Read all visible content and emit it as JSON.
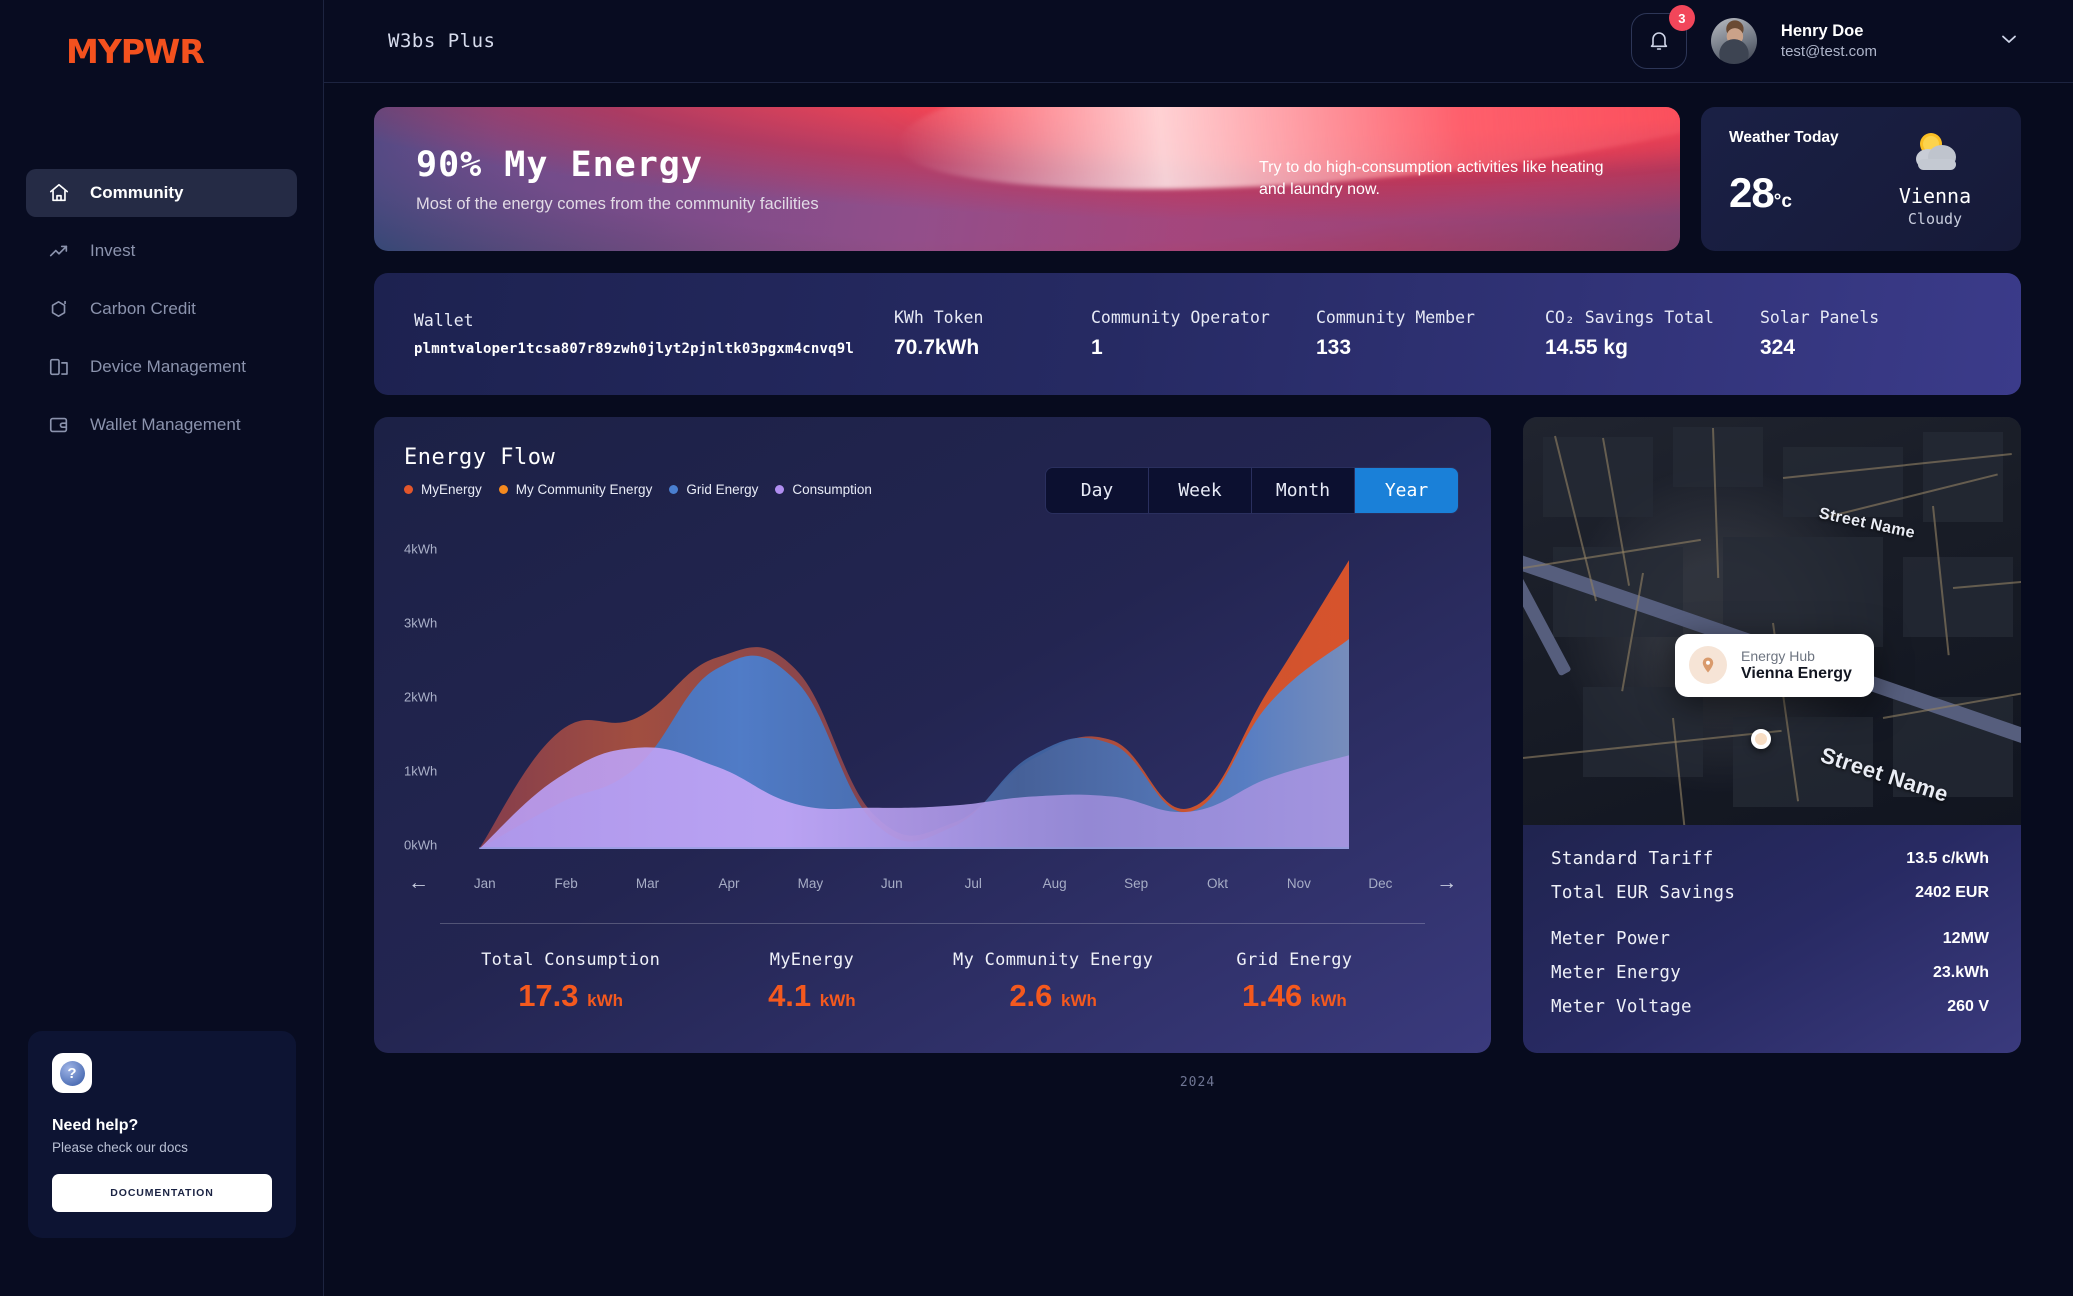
{
  "brand": {
    "logo": "MYPWR"
  },
  "sidebar": {
    "items": [
      {
        "label": "Community",
        "icon": "home-icon",
        "active": true
      },
      {
        "label": "Invest",
        "icon": "trend-up-icon",
        "active": false
      },
      {
        "label": "Carbon Credit",
        "icon": "hexagon-icon",
        "active": false
      },
      {
        "label": "Device Management",
        "icon": "devices-icon",
        "active": false
      },
      {
        "label": "Wallet Management",
        "icon": "wallet-icon",
        "active": false
      }
    ],
    "help": {
      "icon": "question-mark-icon",
      "title": "Need help?",
      "subtitle": "Please check our docs",
      "button": "DOCUMENTATION"
    }
  },
  "topbar": {
    "app_title": "W3bs Plus",
    "notifications_count": "3",
    "user_name": "Henry Doe",
    "user_email": "test@test.com"
  },
  "hero": {
    "title": "90% My Energy",
    "subtitle": "Most of the energy comes from the community facilities",
    "tip": "Try to do high-consumption activities like heating and laundry now."
  },
  "weather": {
    "label": "Weather Today",
    "temperature": "28",
    "unit": "°c",
    "city": "Vienna",
    "condition": "Cloudy",
    "icon": "sun-behind-cloud-icon"
  },
  "stats": {
    "wallet_label": "Wallet",
    "wallet_address": "plmntvaloper1tcsa807r89zwh0jlyt2pjnltk03pgxm4cnvq9l",
    "items": [
      {
        "label": "KWh Token",
        "value": "70.7kWh"
      },
      {
        "label": "Community Operator",
        "value": "1"
      },
      {
        "label": "Community Member",
        "value": "133"
      },
      {
        "label": "CO₂ Savings Total",
        "value": "14.55 kg"
      },
      {
        "label": "Solar Panels",
        "value": "324"
      }
    ]
  },
  "energy_flow": {
    "title": "Energy Flow",
    "range_tabs": [
      {
        "label": "Day",
        "active": false
      },
      {
        "label": "Week",
        "active": false
      },
      {
        "label": "Month",
        "active": false
      },
      {
        "label": "Year",
        "active": true
      }
    ],
    "prev_arrow": "←",
    "next_arrow": "→",
    "totals": [
      {
        "label": "Total Consumption",
        "value": "17.3",
        "unit": "kWh"
      },
      {
        "label": "MyEnergy",
        "value": "4.1",
        "unit": "kWh"
      },
      {
        "label": "My Community Energy",
        "value": "2.6",
        "unit": "kWh"
      },
      {
        "label": "Grid Energy",
        "value": "1.46",
        "unit": "kWh"
      }
    ]
  },
  "chart_data": {
    "type": "area",
    "title": "Energy Flow",
    "xlabel": "",
    "ylabel": "kWh",
    "ylim": [
      0,
      4
    ],
    "yticks": [
      "0kWh",
      "1kWh",
      "2kWh",
      "3kWh",
      "4kWh"
    ],
    "grid": false,
    "legend_position": "top-left",
    "categories": [
      "Jan",
      "Feb",
      "Mar",
      "Apr",
      "May",
      "Jun",
      "Jul",
      "Aug",
      "Sep",
      "Okt",
      "Nov",
      "Dec"
    ],
    "series": [
      {
        "name": "MyEnergy",
        "color": "#e2562b",
        "values": [
          0.0,
          1.55,
          1.75,
          2.55,
          2.4,
          0.45,
          0.35,
          1.2,
          1.45,
          0.55,
          2.15,
          3.85
        ]
      },
      {
        "name": "My Community Energy",
        "color": "#f58a1f",
        "values": [
          0.0,
          1.2,
          1.4,
          2.1,
          1.95,
          0.4,
          0.3,
          1.0,
          1.2,
          0.45,
          1.8,
          3.2
        ]
      },
      {
        "name": "Grid Energy",
        "color": "#4a7fd0",
        "values": [
          0.0,
          0.6,
          1.1,
          2.4,
          2.25,
          0.35,
          0.3,
          1.25,
          1.4,
          0.5,
          1.95,
          2.8
        ]
      },
      {
        "name": "Consumption",
        "color": "#b08ef0",
        "values": [
          0.0,
          0.95,
          1.35,
          1.1,
          0.6,
          0.55,
          0.58,
          0.7,
          0.7,
          0.5,
          0.95,
          1.25
        ]
      }
    ]
  },
  "map": {
    "hub_label": "Energy Hub",
    "hub_name": "Vienna Energy",
    "pin_icon": "location-pin-icon",
    "street_label_top": "Street Name",
    "street_label_bottom": "Street Name",
    "info": [
      {
        "key": "Standard Tariff",
        "value": "13.5 c/kWh"
      },
      {
        "key": "Total EUR Savings",
        "value": "2402 EUR"
      },
      {
        "key": "Meter Power",
        "value": "12MW"
      },
      {
        "key": "Meter Energy",
        "value": "23.kWh"
      },
      {
        "key": "Meter Voltage",
        "value": "260 V"
      }
    ]
  },
  "footer": {
    "year": "2024"
  },
  "colors": {
    "accent": "#f4511e",
    "tab_active": "#1a80d8",
    "badge": "#f2465a",
    "my_energy": "#e2562b",
    "community_energy": "#f58a1f",
    "grid_energy": "#4a7fd0",
    "consumption": "#b08ef0"
  }
}
